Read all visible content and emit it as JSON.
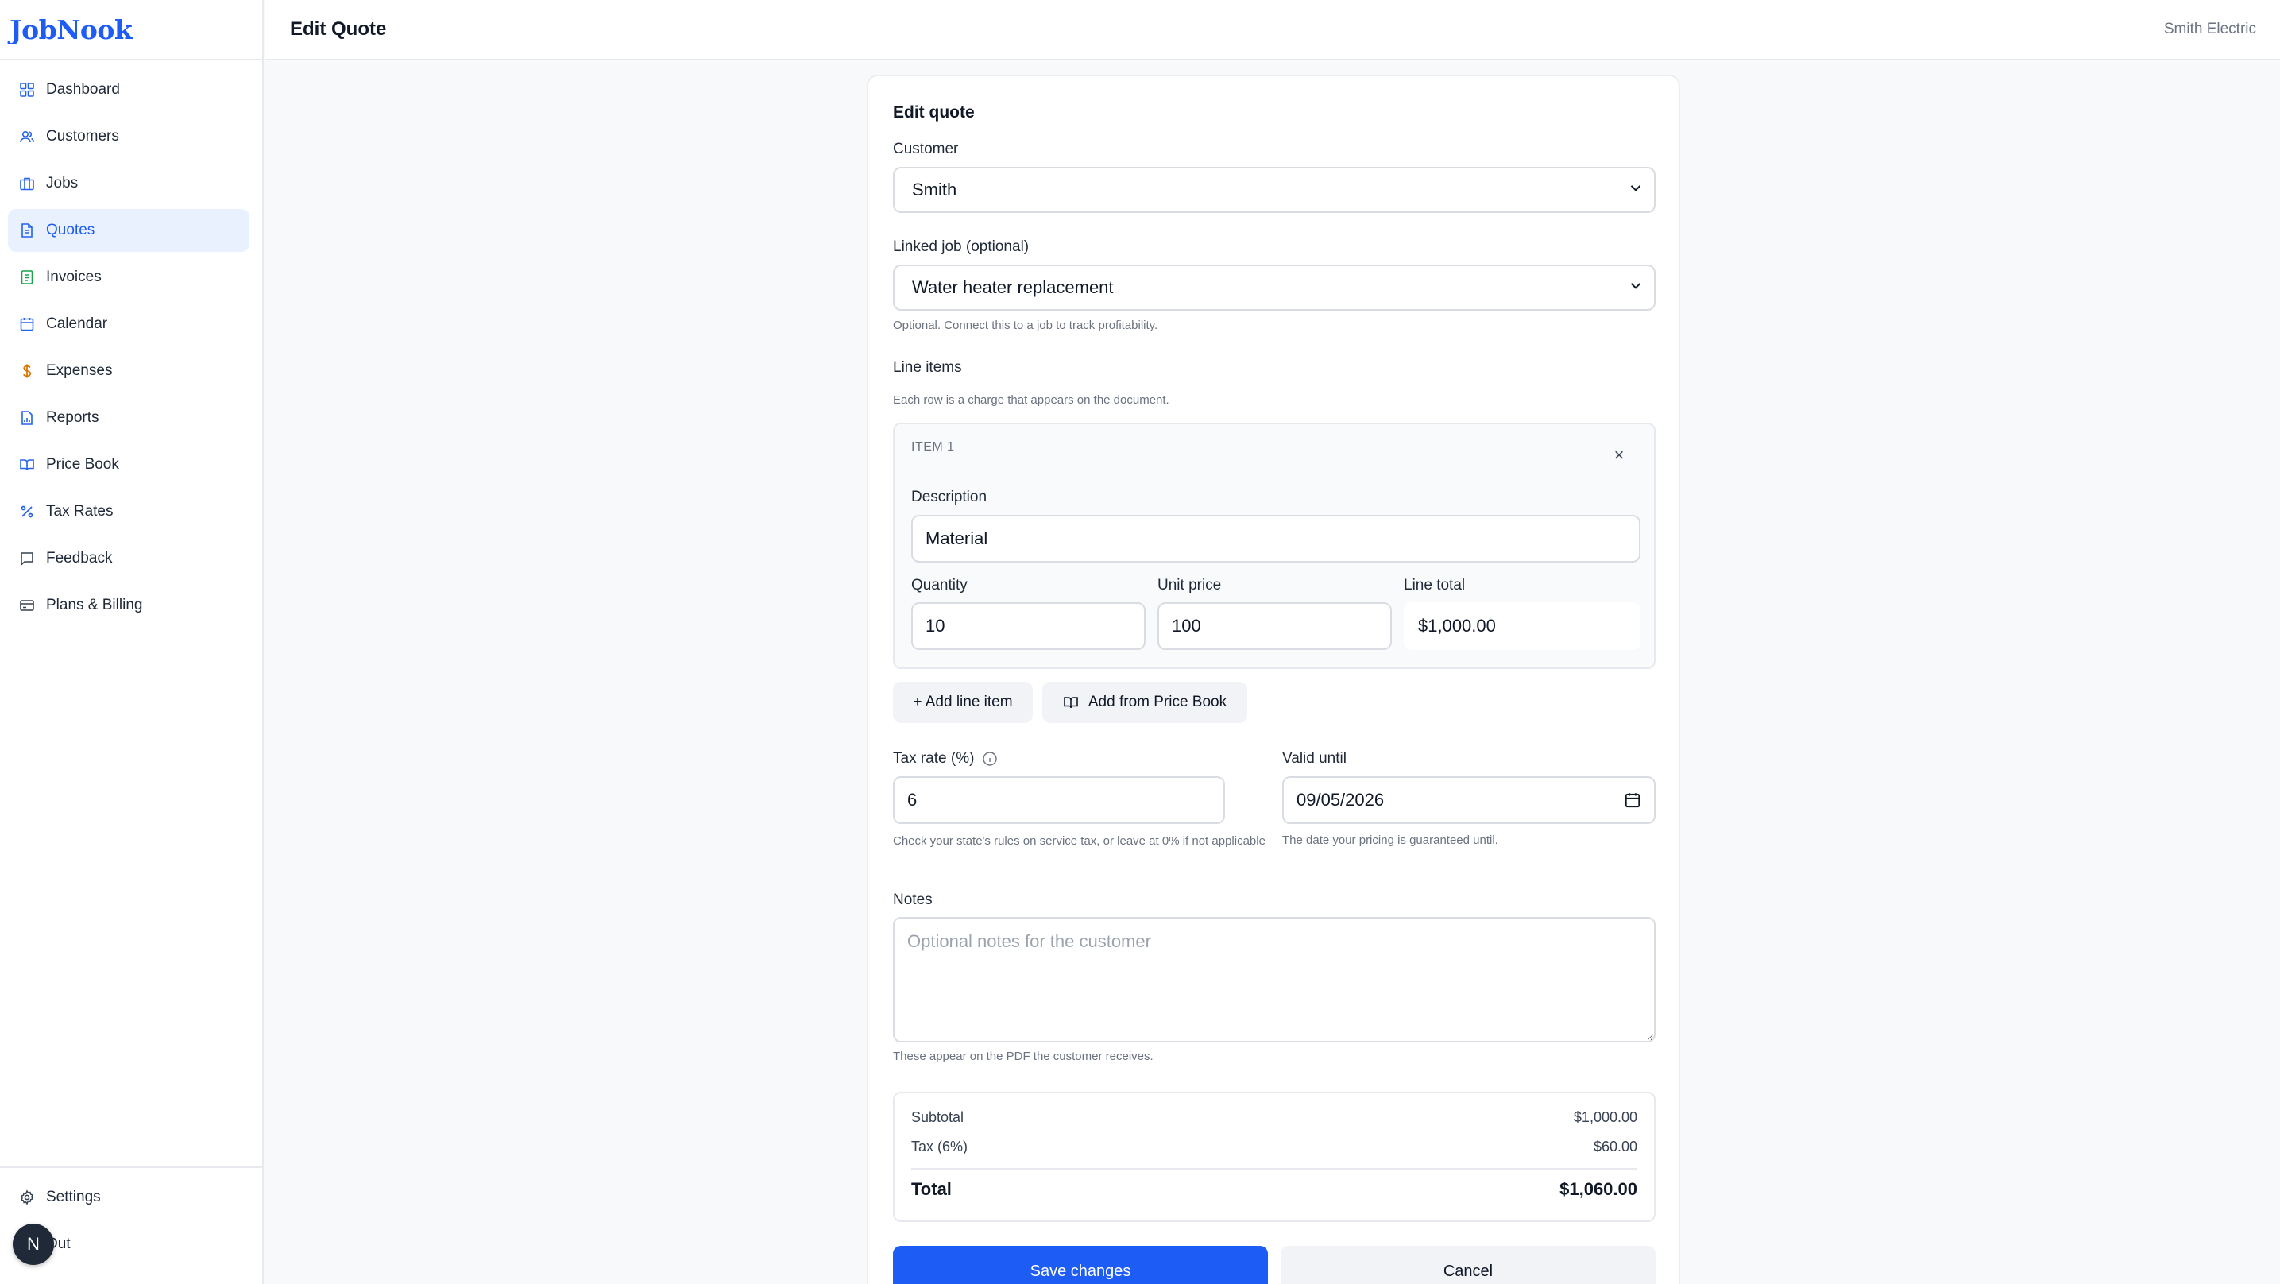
{
  "app": {
    "logo": "JobNook",
    "org_name": "Smith Electric",
    "page_title": "Edit Quote"
  },
  "sidebar": {
    "items": [
      {
        "label": "Dashboard",
        "icon": "grid-icon",
        "active": false
      },
      {
        "label": "Customers",
        "icon": "users-icon",
        "active": false
      },
      {
        "label": "Jobs",
        "icon": "briefcase-icon",
        "active": false
      },
      {
        "label": "Quotes",
        "icon": "document-icon",
        "active": true
      },
      {
        "label": "Invoices",
        "icon": "invoice-icon",
        "active": false
      },
      {
        "label": "Calendar",
        "icon": "calendar-icon",
        "active": false
      },
      {
        "label": "Expenses",
        "icon": "dollar-icon",
        "active": false
      },
      {
        "label": "Reports",
        "icon": "report-icon",
        "active": false
      },
      {
        "label": "Price Book",
        "icon": "book-icon",
        "active": false
      },
      {
        "label": "Tax Rates",
        "icon": "percent-icon",
        "active": false
      },
      {
        "label": "Feedback",
        "icon": "chat-icon",
        "active": false
      },
      {
        "label": "Plans & Billing",
        "icon": "card-icon",
        "active": false
      }
    ],
    "bottom": [
      {
        "label": "Settings",
        "icon": "gear-icon"
      },
      {
        "label": "Out",
        "icon": "logout-icon"
      }
    ],
    "avatar_initial": "N"
  },
  "form": {
    "title": "Edit quote",
    "customer": {
      "label": "Customer",
      "value": "Smith"
    },
    "linked_job": {
      "label": "Linked job (optional)",
      "value": "Water heater replacement",
      "help": "Optional. Connect this to a job to track profitability."
    },
    "line_items": {
      "label": "Line items",
      "help": "Each row is a charge that appears on the document.",
      "items": [
        {
          "header": "ITEM 1",
          "description_label": "Description",
          "description": "Material",
          "quantity_label": "Quantity",
          "quantity": "10",
          "unit_price_label": "Unit price",
          "unit_price": "100",
          "line_total_label": "Line total",
          "line_total": "$1,000.00",
          "remove_symbol": "×"
        }
      ],
      "add_line_label": "+ Add line item",
      "add_price_book_label": "Add from Price Book"
    },
    "tax": {
      "label": "Tax rate (%)",
      "value": "6",
      "help": "Check your state's rules on service tax, or leave at 0% if not applicable"
    },
    "valid_until": {
      "label": "Valid until",
      "value": "09/05/2026",
      "help": "The date your pricing is guaranteed until."
    },
    "notes": {
      "label": "Notes",
      "placeholder": "Optional notes for the customer",
      "help": "These appear on the PDF the customer receives."
    },
    "totals": {
      "subtotal_label": "Subtotal",
      "subtotal": "$1,000.00",
      "tax_label": "Tax (6%)",
      "tax": "$60.00",
      "total_label": "Total",
      "total": "$1,060.00"
    },
    "save_label": "Save changes",
    "cancel_label": "Cancel"
  },
  "colors": {
    "accent": "#1d5cf5",
    "active_bg": "#eaf1fe"
  }
}
